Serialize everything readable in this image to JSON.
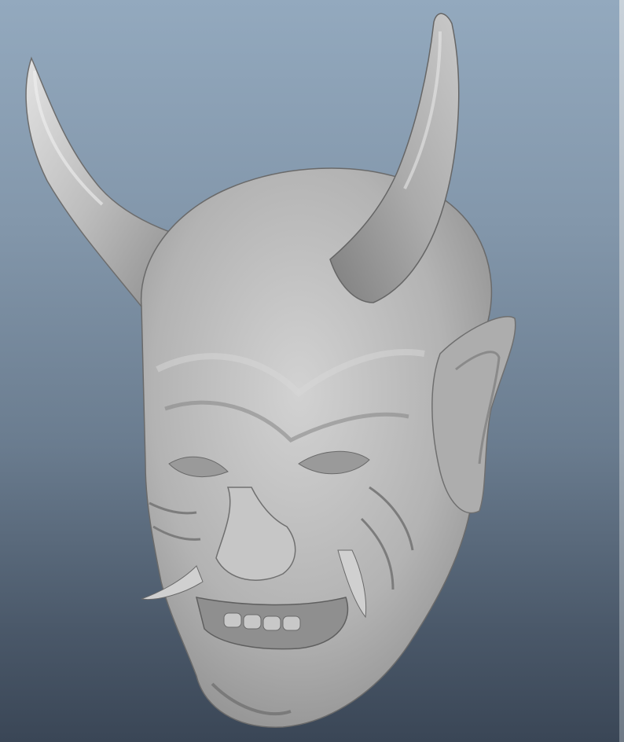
{
  "viewport": {
    "content": "3d-sculpt-model",
    "background_top": "#93a9be",
    "background_bottom": "#3a4656",
    "model_color": "#b8b8b8"
  }
}
